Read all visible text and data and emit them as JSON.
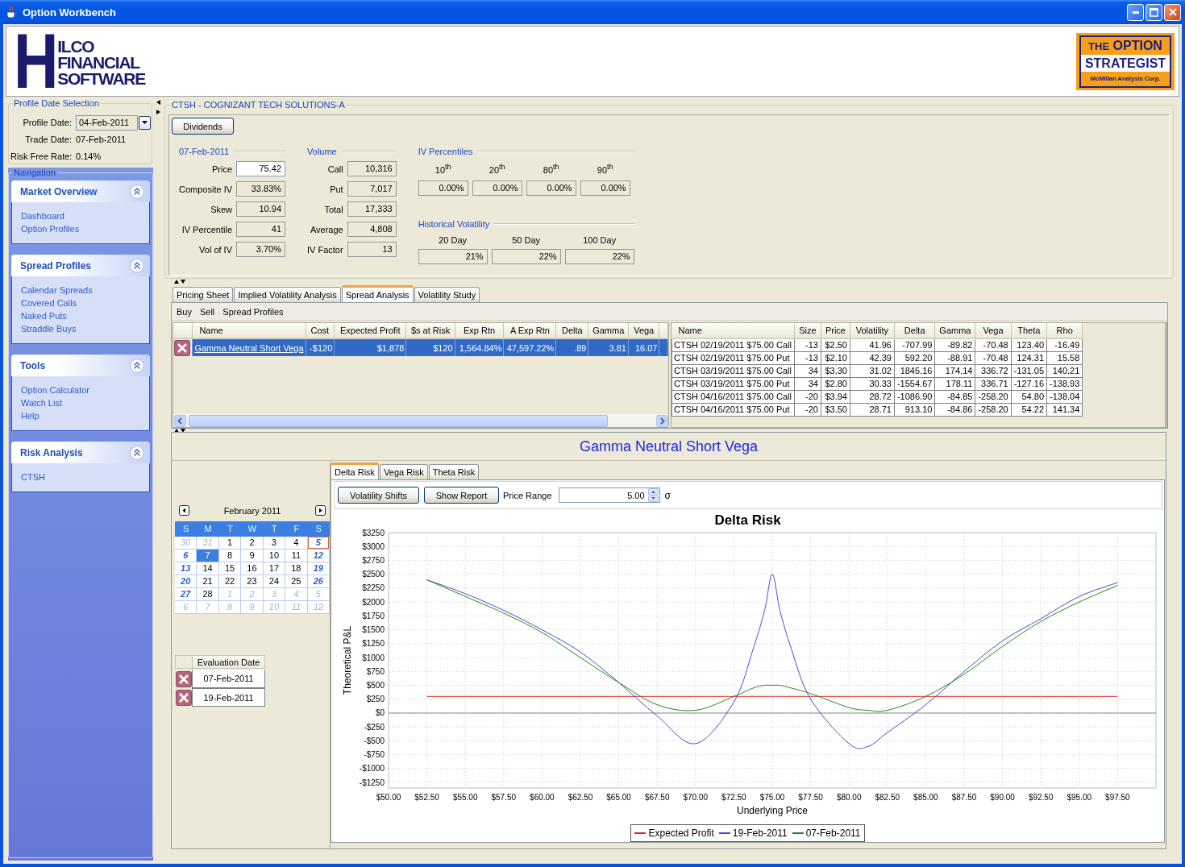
{
  "window": {
    "title": "Option Workbench"
  },
  "header": {
    "logo": {
      "initial": "H",
      "lines": [
        "ILCO",
        "FINANCIAL",
        "SOFTWARE"
      ]
    },
    "partner_logo": {
      "top_small": "THE",
      "top": "OPTION",
      "middle": "STRATEGIST",
      "bottom": "McMillan Analysis Corp."
    }
  },
  "profile_date_selection": {
    "title": "Profile Date Selection",
    "fields": [
      {
        "label": "Profile Date:",
        "value": "04-Feb-2011",
        "kind": "dropdown"
      },
      {
        "label": "Trade Date:",
        "value": "07-Feb-2011",
        "kind": "text"
      },
      {
        "label": "Risk Free Rate:",
        "value": "0.14%",
        "kind": "text"
      }
    ]
  },
  "navigation": {
    "title": "Navigation",
    "sections": [
      {
        "title": "Market Overview",
        "expanded": true,
        "items": [
          "Dashboard",
          "Option Profiles"
        ]
      },
      {
        "title": "Spread Profiles",
        "expanded": true,
        "items": [
          "Calendar Spreads",
          "Covered Calls",
          "Naked Puts",
          "Straddle Buys"
        ]
      },
      {
        "title": "Tools",
        "expanded": true,
        "items": [
          "Option Calculator",
          "Watch List",
          "Help"
        ]
      },
      {
        "title": "Risk Analysis",
        "expanded": true,
        "items": [
          "CTSH"
        ]
      }
    ]
  },
  "stock": {
    "title": "CTSH - COGNIZANT TECH SOLUTIONS-A",
    "button": "Dividends",
    "quote": {
      "title": "07-Feb-2011",
      "rows": [
        {
          "label": "Price",
          "value": "75.42",
          "editable": true
        },
        {
          "label": "Composite IV",
          "value": "33.83%",
          "editable": false
        },
        {
          "label": "Skew",
          "value": "10.94",
          "editable": false
        },
        {
          "label": "IV Percentile",
          "value": "41",
          "editable": false
        },
        {
          "label": "Vol of IV",
          "value": "3.70%",
          "editable": false
        }
      ]
    },
    "volume": {
      "title": "Volume",
      "rows": [
        {
          "label": "Call",
          "value": "10,316",
          "editable": false
        },
        {
          "label": "Put",
          "value": "7,017",
          "editable": false
        },
        {
          "label": "Total",
          "value": "17,333",
          "editable": false
        },
        {
          "label": "Average",
          "value": "4,808",
          "editable": false
        },
        {
          "label": "IV Factor",
          "value": "13",
          "editable": false
        }
      ]
    },
    "iv_percentiles": {
      "title": "IV Percentiles",
      "columns": [
        {
          "label": "10$^{th}$",
          "value": "0.00%"
        },
        {
          "label": "20$^{th}$",
          "value": "0.00%"
        },
        {
          "label": "80$^{th}$",
          "value": "0.00%"
        },
        {
          "label": "90$^{th}$",
          "value": "0.00%"
        }
      ]
    },
    "historical_volatility": {
      "title": "Historical Volatility",
      "columns": [
        {
          "label": "20 Day",
          "value": "21%"
        },
        {
          "label": "50 Day",
          "value": "22%"
        },
        {
          "label": "100 Day",
          "value": "22%"
        }
      ]
    }
  },
  "analysis_tabs": [
    {
      "label": "Pricing Sheet",
      "selected": false
    },
    {
      "label": "Implied Volatility Analysis",
      "selected": false
    },
    {
      "label": "Spread Analysis",
      "selected": true
    },
    {
      "label": "Volatility Study",
      "selected": false
    }
  ],
  "menu": [
    "Buy",
    "Sell",
    "Spread Profiles"
  ],
  "spreads_table": {
    "columns": [
      "Name",
      "Cost",
      "Expected Profit",
      "$s at Risk",
      "Exp Rtn",
      "A Exp Rtn",
      "Delta",
      "Gamma",
      "Vega"
    ],
    "rows": [
      {
        "selected": true,
        "cells": [
          "Gamma Neutral Short Vega",
          "-$120",
          "$1,878",
          "$120",
          "1,564.84%",
          "47,597.22%",
          ".89",
          "3.81",
          "16.07"
        ]
      }
    ]
  },
  "legs_table": {
    "columns": [
      "Name",
      "Size",
      "Price",
      "Volatility",
      "Delta",
      "Gamma",
      "Vega",
      "Theta",
      "Rho"
    ],
    "rows": [
      [
        "CTSH 02/19/2011 $75.00 Call",
        "-13",
        "$2.50",
        "41.96",
        "-707.99",
        "-89.82",
        "-70.48",
        "123.40",
        "-16.49"
      ],
      [
        "CTSH 02/19/2011 $75.00 Put",
        "-13",
        "$2.10",
        "42.39",
        "592.20",
        "-88.91",
        "-70.48",
        "124.31",
        "15.58"
      ],
      [
        "CTSH 03/19/2011 $75.00 Call",
        "34",
        "$3.30",
        "31.02",
        "1845.16",
        "174.14",
        "336.72",
        "-131.05",
        "140.21"
      ],
      [
        "CTSH 03/19/2011 $75.00 Put",
        "34",
        "$2.80",
        "30.33",
        "-1554.67",
        "178.11",
        "336.71",
        "-127.16",
        "-138.93"
      ],
      [
        "CTSH 04/16/2011 $75.00 Call",
        "-20",
        "$3.94",
        "28.72",
        "-1086.90",
        "-84.85",
        "-258.20",
        "54.80",
        "-138.04"
      ],
      [
        "CTSH 04/16/2011 $75.00 Put",
        "-20",
        "$3.50",
        "28.71",
        "913.10",
        "-84.86",
        "-258.20",
        "54.22",
        "141.34"
      ]
    ]
  },
  "risk_panel": {
    "title": "Gamma Neutral Short Vega",
    "calendar": {
      "month": "February 2011",
      "weekdays": [
        "S",
        "M",
        "T",
        "W",
        "T",
        "F",
        "S"
      ],
      "weeks": [
        {
          "days": [
            {
              "label": "30",
              "kind": "other",
              "selected": false,
              "outlined": false
            },
            {
              "label": "31",
              "kind": "other",
              "selected": false,
              "outlined": false
            },
            {
              "label": "1",
              "kind": "day",
              "selected": false,
              "outlined": false
            },
            {
              "label": "2",
              "kind": "day",
              "selected": false,
              "outlined": false
            },
            {
              "label": "3",
              "kind": "day",
              "selected": false,
              "outlined": false
            },
            {
              "label": "4",
              "kind": "day",
              "selected": false,
              "outlined": false
            },
            {
              "label": "5",
              "kind": "weekend",
              "selected": false,
              "outlined": true
            }
          ]
        },
        {
          "days": [
            {
              "label": "6",
              "kind": "weekend",
              "selected": false,
              "outlined": false
            },
            {
              "label": "7",
              "kind": "day",
              "selected": true,
              "outlined": false
            },
            {
              "label": "8",
              "kind": "day",
              "selected": false,
              "outlined": false
            },
            {
              "label": "9",
              "kind": "day",
              "selected": false,
              "outlined": false
            },
            {
              "label": "10",
              "kind": "day",
              "selected": false,
              "outlined": false
            },
            {
              "label": "11",
              "kind": "day",
              "selected": false,
              "outlined": false
            },
            {
              "label": "12",
              "kind": "weekend",
              "selected": false,
              "outlined": false
            }
          ]
        },
        {
          "days": [
            {
              "label": "13",
              "kind": "weekend",
              "selected": false,
              "outlined": false
            },
            {
              "label": "14",
              "kind": "day",
              "selected": false,
              "outlined": false
            },
            {
              "label": "15",
              "kind": "day",
              "selected": false,
              "outlined": false
            },
            {
              "label": "16",
              "kind": "day",
              "selected": false,
              "outlined": false
            },
            {
              "label": "17",
              "kind": "day",
              "selected": false,
              "outlined": false
            },
            {
              "label": "18",
              "kind": "day",
              "selected": false,
              "outlined": false
            },
            {
              "label": "19",
              "kind": "weekend",
              "selected": false,
              "outlined": false
            }
          ]
        },
        {
          "days": [
            {
              "label": "20",
              "kind": "weekend",
              "selected": false,
              "outlined": false
            },
            {
              "label": "21",
              "kind": "day",
              "selected": false,
              "outlined": false
            },
            {
              "label": "22",
              "kind": "day",
              "selected": false,
              "outlined": false
            },
            {
              "label": "23",
              "kind": "day",
              "selected": false,
              "outlined": false
            },
            {
              "label": "24",
              "kind": "day",
              "selected": false,
              "outlined": false
            },
            {
              "label": "25",
              "kind": "day",
              "selected": false,
              "outlined": false
            },
            {
              "label": "26",
              "kind": "weekend",
              "selected": false,
              "outlined": false
            }
          ]
        },
        {
          "days": [
            {
              "label": "27",
              "kind": "weekend",
              "selected": false,
              "outlined": false
            },
            {
              "label": "28",
              "kind": "day",
              "selected": false,
              "outlined": false
            },
            {
              "label": "1",
              "kind": "other",
              "selected": false,
              "outlined": false
            },
            {
              "label": "2",
              "kind": "other",
              "selected": false,
              "outlined": false
            },
            {
              "label": "3",
              "kind": "other",
              "selected": false,
              "outlined": false
            },
            {
              "label": "4",
              "kind": "other",
              "selected": false,
              "outlined": false
            },
            {
              "label": "5",
              "kind": "other",
              "selected": false,
              "outlined": false
            }
          ]
        },
        {
          "days": [
            {
              "label": "6",
              "kind": "other",
              "selected": false,
              "outlined": false
            },
            {
              "label": "7",
              "kind": "other",
              "selected": false,
              "outlined": false
            },
            {
              "label": "8",
              "kind": "other",
              "selected": false,
              "outlined": false
            },
            {
              "label": "9",
              "kind": "other",
              "selected": false,
              "outlined": false
            },
            {
              "label": "10",
              "kind": "other",
              "selected": false,
              "outlined": false
            },
            {
              "label": "11",
              "kind": "other",
              "selected": false,
              "outlined": false
            },
            {
              "label": "12",
              "kind": "other",
              "selected": false,
              "outlined": false
            }
          ]
        }
      ]
    },
    "evaluation_dates": {
      "column": "Evaluation Date",
      "dates": [
        "07-Feb-2011",
        "19-Feb-2011"
      ]
    },
    "tabs": [
      {
        "label": "Delta Risk",
        "selected": true
      },
      {
        "label": "Vega Risk",
        "selected": false
      },
      {
        "label": "Theta Risk",
        "selected": false
      }
    ],
    "buttons": [
      "Volatility Shifts",
      "Show Report"
    ],
    "price_range": {
      "label": "Price Range",
      "value": "5.00",
      "unit": "σ"
    },
    "chart_data": {
      "type": "line",
      "title": "Delta Risk",
      "xlabel": "Underlying Price",
      "ylabel": "Theoretical P&L",
      "grid": true,
      "legend": "bottom",
      "x": [
        52.5,
        55,
        57.5,
        60,
        62.5,
        65,
        67.5,
        70,
        72.5,
        73.75,
        74.5,
        75,
        75.5,
        76.25,
        77.5,
        80,
        81.25,
        82.5,
        85,
        87.5,
        90,
        92.5,
        95,
        97.5
      ],
      "series": [
        {
          "name": "Expected Profit",
          "color": "#e02020",
          "values": [
            300,
            300,
            300,
            300,
            300,
            300,
            300,
            300,
            300,
            300,
            300,
            300,
            300,
            300,
            300,
            300,
            300,
            300,
            300,
            300,
            300,
            300,
            300,
            300
          ]
        },
        {
          "name": "19-Feb-2011",
          "color": "#4848dc",
          "values": [
            2400,
            2150,
            1850,
            1500,
            1100,
            550,
            -50,
            -550,
            200,
            1150,
            1850,
            2500,
            1850,
            1150,
            250,
            -550,
            -600,
            -350,
            150,
            750,
            1300,
            1700,
            2100,
            2350
          ]
        },
        {
          "name": "07-Feb-2011",
          "color": "#1e8a1e",
          "values": [
            2400,
            2100,
            1800,
            1450,
            1000,
            550,
            150,
            50,
            300,
            450,
            500,
            500,
            500,
            450,
            350,
            100,
            50,
            50,
            300,
            700,
            1200,
            1650,
            2000,
            2300
          ]
        }
      ],
      "xlim": [
        50,
        100
      ],
      "ylim": [
        -1350,
        3250
      ],
      "xticks": [
        {
          "value": 50,
          "label": "$50.00"
        },
        {
          "value": 52.5,
          "label": "$52.50"
        },
        {
          "value": 55,
          "label": "$55.00"
        },
        {
          "value": 57.5,
          "label": "$57.50"
        },
        {
          "value": 60,
          "label": "$60.00"
        },
        {
          "value": 62.5,
          "label": "$62.50"
        },
        {
          "value": 65,
          "label": "$65.00"
        },
        {
          "value": 67.5,
          "label": "$67.50"
        },
        {
          "value": 70,
          "label": "$70.00"
        },
        {
          "value": 72.5,
          "label": "$72.50"
        },
        {
          "value": 75,
          "label": "$75.00"
        },
        {
          "value": 77.5,
          "label": "$77.50"
        },
        {
          "value": 80,
          "label": "$80.00"
        },
        {
          "value": 82.5,
          "label": "$82.50"
        },
        {
          "value": 85,
          "label": "$85.00"
        },
        {
          "value": 87.5,
          "label": "$87.50"
        },
        {
          "value": 90,
          "label": "$90.00"
        },
        {
          "value": 92.5,
          "label": "$92.50"
        },
        {
          "value": 95,
          "label": "$95.00"
        },
        {
          "value": 97.5,
          "label": "$97.50"
        }
      ],
      "yticks": [
        {
          "value": -1250,
          "label": "-$1250"
        },
        {
          "value": -1000,
          "label": "-$1000"
        },
        {
          "value": -750,
          "label": "-$750"
        },
        {
          "value": -500,
          "label": "-$500"
        },
        {
          "value": -250,
          "label": "-$250"
        },
        {
          "value": 0,
          "label": "$0"
        },
        {
          "value": 250,
          "label": "$250"
        },
        {
          "value": 500,
          "label": "$500"
        },
        {
          "value": 750,
          "label": "$750"
        },
        {
          "value": 1000,
          "label": "$1000"
        },
        {
          "value": 1250,
          "label": "$1250"
        },
        {
          "value": 1500,
          "label": "$1500"
        },
        {
          "value": 1750,
          "label": "$1750"
        },
        {
          "value": 2000,
          "label": "$2000"
        },
        {
          "value": 2250,
          "label": "$2250"
        },
        {
          "value": 2500,
          "label": "$2500"
        },
        {
          "value": 2750,
          "label": "$2750"
        },
        {
          "value": 3000,
          "label": "$3000"
        },
        {
          "value": 3250,
          "label": "$3250"
        }
      ]
    }
  }
}
